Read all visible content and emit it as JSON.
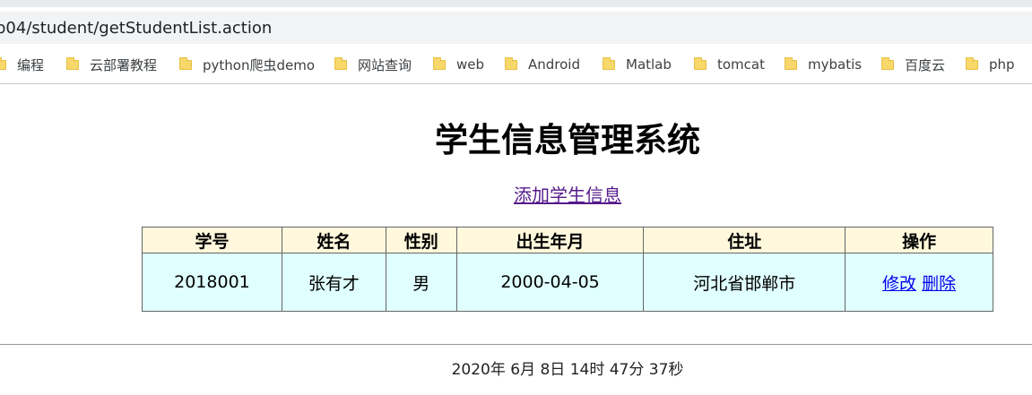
{
  "browser": {
    "address": "b04/student/getStudentList.action",
    "bookmarks": [
      {
        "label": "编程"
      },
      {
        "label": "云部署教程"
      },
      {
        "label": "python爬虫demo"
      },
      {
        "label": "网站查询"
      },
      {
        "label": "web"
      },
      {
        "label": "Android"
      },
      {
        "label": "Matlab"
      },
      {
        "label": "tomcat"
      },
      {
        "label": "mybatis"
      },
      {
        "label": "百度云"
      },
      {
        "label": "php"
      }
    ]
  },
  "page": {
    "title": "学生信息管理系统",
    "add_link": "添加学生信息",
    "table": {
      "headers": [
        "学号",
        "姓名",
        "性别",
        "出生年月",
        "住址",
        "操作"
      ],
      "rows": [
        {
          "id": "2018001",
          "name": "张有才",
          "gender": "男",
          "birth": "2000-04-05",
          "address": "河北省邯郸市",
          "edit": "修改",
          "delete": "删除"
        }
      ]
    },
    "timestamp": "2020年 6月 8日 14时 47分 37秒"
  },
  "colors": {
    "header_bg": "#fff8dc",
    "row_bg": "#e0ffff",
    "visited_link": "#551a8b",
    "link": "#0000ee"
  }
}
